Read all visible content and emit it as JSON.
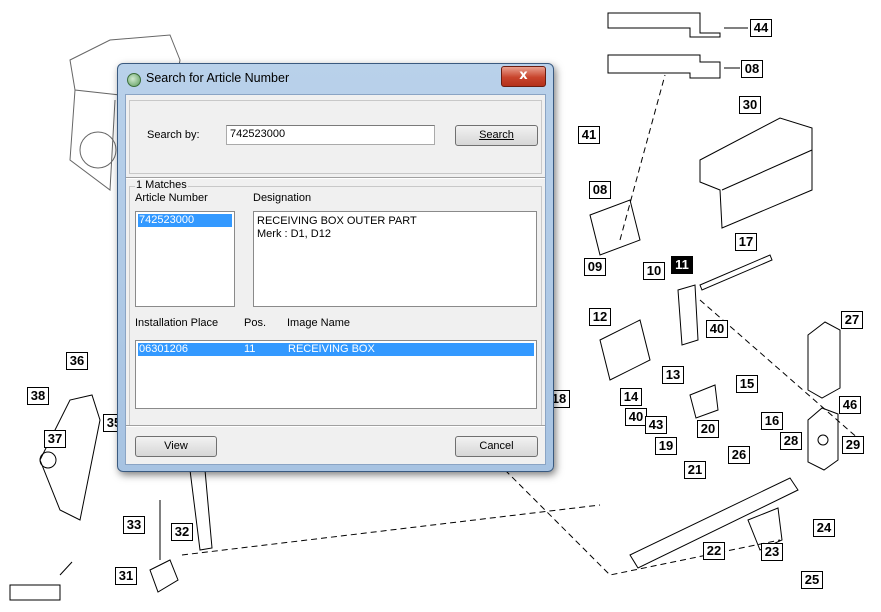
{
  "callouts": [
    "44",
    "08",
    "30",
    "41",
    "08",
    "17",
    "11",
    "09",
    "10",
    "12",
    "40",
    "27",
    "36",
    "38",
    "37",
    "35",
    "14",
    "13",
    "15",
    "18",
    "40",
    "43",
    "20",
    "16",
    "46",
    "28",
    "29",
    "19",
    "26",
    "21",
    "33",
    "32",
    "31",
    "22",
    "24",
    "23",
    "25"
  ],
  "dialog": {
    "title": "Search for Article Number",
    "close_label": "x",
    "search_by_label": "Search by:",
    "search_value": "742523000",
    "search_button": "Search",
    "matches_label": "1 Matches",
    "article_number_header": "Article Number",
    "designation_header": "Designation",
    "article_numbers": [
      "742523000"
    ],
    "designation_lines": [
      "RECEIVING BOX OUTER PART",
      "Merk : D1, D12"
    ],
    "installation_header": "Installation Place",
    "pos_header": "Pos.",
    "image_name_header": "Image Name",
    "installations": [
      {
        "place": "06301206",
        "pos": "11",
        "image": "RECEIVING BOX"
      }
    ],
    "view_button": "View",
    "cancel_button": "Cancel"
  },
  "colors": {
    "selection": "#3399ff",
    "title_bar": "#b9d1ea",
    "close_button": "#c8442c"
  }
}
